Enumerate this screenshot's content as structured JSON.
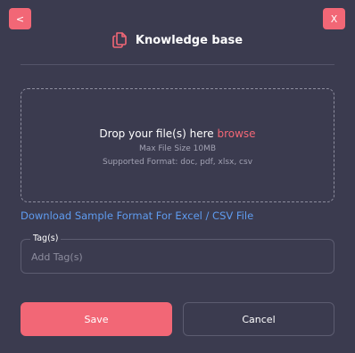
{
  "colors": {
    "background": "#3b3b4f",
    "accent": "#f26776",
    "link": "#5f9cf0",
    "muted_text": "#a2a2b3"
  },
  "nav": {
    "back_label": "<",
    "close_label": "X"
  },
  "header": {
    "icon": "copy-document-icon",
    "title": "Knowledge base"
  },
  "dropzone": {
    "prompt": "Drop your file(s) here",
    "browse_label": "browse",
    "max_size": "Max File Size 10MB",
    "formats": "Supported Format: doc, pdf, xlsx, csv"
  },
  "download_link": "Download Sample Format For Excel / CSV File",
  "tags": {
    "label": "Tag(s)",
    "placeholder": "Add Tag(s)",
    "value": ""
  },
  "actions": {
    "save_label": "Save",
    "cancel_label": "Cancel"
  }
}
